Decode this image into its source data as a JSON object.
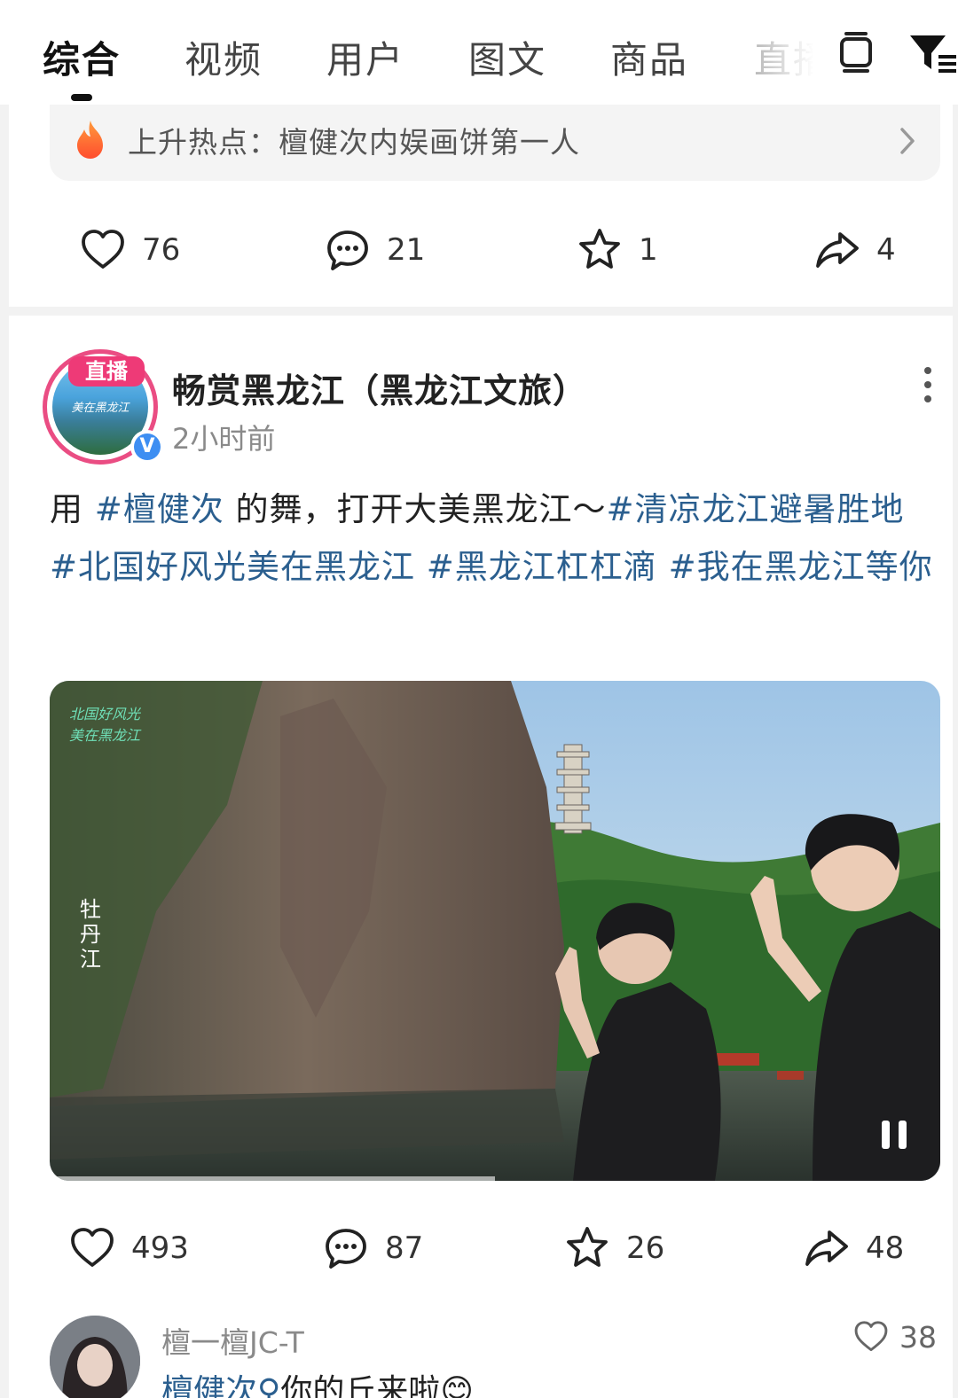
{
  "tabs": [
    {
      "label": "综合",
      "active": true
    },
    {
      "label": "视频"
    },
    {
      "label": "用户"
    },
    {
      "label": "图文"
    },
    {
      "label": "商品"
    },
    {
      "label": "直播"
    }
  ],
  "toolbar_icons": [
    "device-icon",
    "filter-icon"
  ],
  "post1": {
    "hot_prefix": "上升热点：",
    "hot_topic": "檀健次内娱画饼第一人",
    "likes": "76",
    "comments": "21",
    "favorites": "1",
    "shares": "4"
  },
  "post2": {
    "live_badge": "直播",
    "avatar_caption": "美在黑龙江",
    "verified_mark": "V",
    "author": "畅赏黑龙江（黑龙江文旅）",
    "time": "2小时前",
    "text_1": "用 ",
    "tag_1": "#檀健次",
    "text_2": " 的舞，打开大美黑龙江～",
    "tag_2": "#清凉龙江避暑胜地",
    "tag_3": "#北国好风光美在黑龙江",
    "tag_4": "#黑龙江杠杠滴",
    "tag_5": "#我在黑龙江等你",
    "video_watermark_1": "北国好风光",
    "video_watermark_2": "美在黑龙江",
    "video_location": "牡丹江",
    "video_progress": 0.5,
    "likes": "493",
    "comments": "87",
    "favorites": "26",
    "shares": "48"
  },
  "comment": {
    "user": "檀一檀JC-T",
    "likes": "38",
    "mention": "檀健次",
    "text": "你的丘来啦😊"
  },
  "colors": {
    "hashtag": "#2b5f8f",
    "live_pink": "#ee3a77",
    "verified_blue": "#3d8ef2"
  }
}
